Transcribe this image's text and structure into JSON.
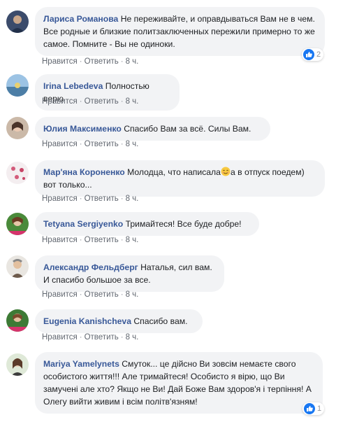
{
  "actions": {
    "like": "Нравится",
    "reply": "Ответить",
    "sep": "·"
  },
  "comments": [
    {
      "author": "Лариса Романова",
      "text": "Не переживайте, и оправдываться Вам не в чем. Все родные и близкие политзаключенных пережили примерно то же самое. Помните - Вы не одиноки.",
      "time": "8 ч.",
      "reactions": "2"
    },
    {
      "author": "Irina Lebedeva",
      "text": "Полностью верю",
      "time": "8 ч."
    },
    {
      "author": "Юлия Максименко",
      "text": "Спасибо Вам за всё. Силы Вам.",
      "time": "8 ч."
    },
    {
      "author": "Мар'яна Короненко",
      "text_before": "Молодца, что написала",
      "text_after": "а в отпуск поедем) вот только...",
      "emoji": "smiling-face-icon",
      "time": "8 ч."
    },
    {
      "author": "Tetyana Sergiyenko",
      "text": "Тримайтеся! Все буде добре!",
      "time": "8 ч."
    },
    {
      "author": "Александр Фельдберг",
      "text": "Наталья, сил вам. И спасибо большое за все.",
      "time": "8 ч."
    },
    {
      "author": "Eugenia Kanishcheva",
      "text": "Спасибо вам.",
      "time": "8 ч."
    },
    {
      "author": "Mariya Yamelynets",
      "text": "Смуток... це дійсно Ви зовсім немаєте свого особистого життя!!! Але тримайтеся! Особисто я вірю, що Ви замучені але хто? Якщо не Ви! Дай Боже Вам здоров'я і терпіння! А Олегу вийти живим і всім політв'язням!",
      "time": "8 ч.",
      "reactions": "1"
    }
  ],
  "colors": {
    "author": "#385898",
    "bubble": "#f2f3f5",
    "meta": "#616770",
    "like": "#1877f2"
  }
}
